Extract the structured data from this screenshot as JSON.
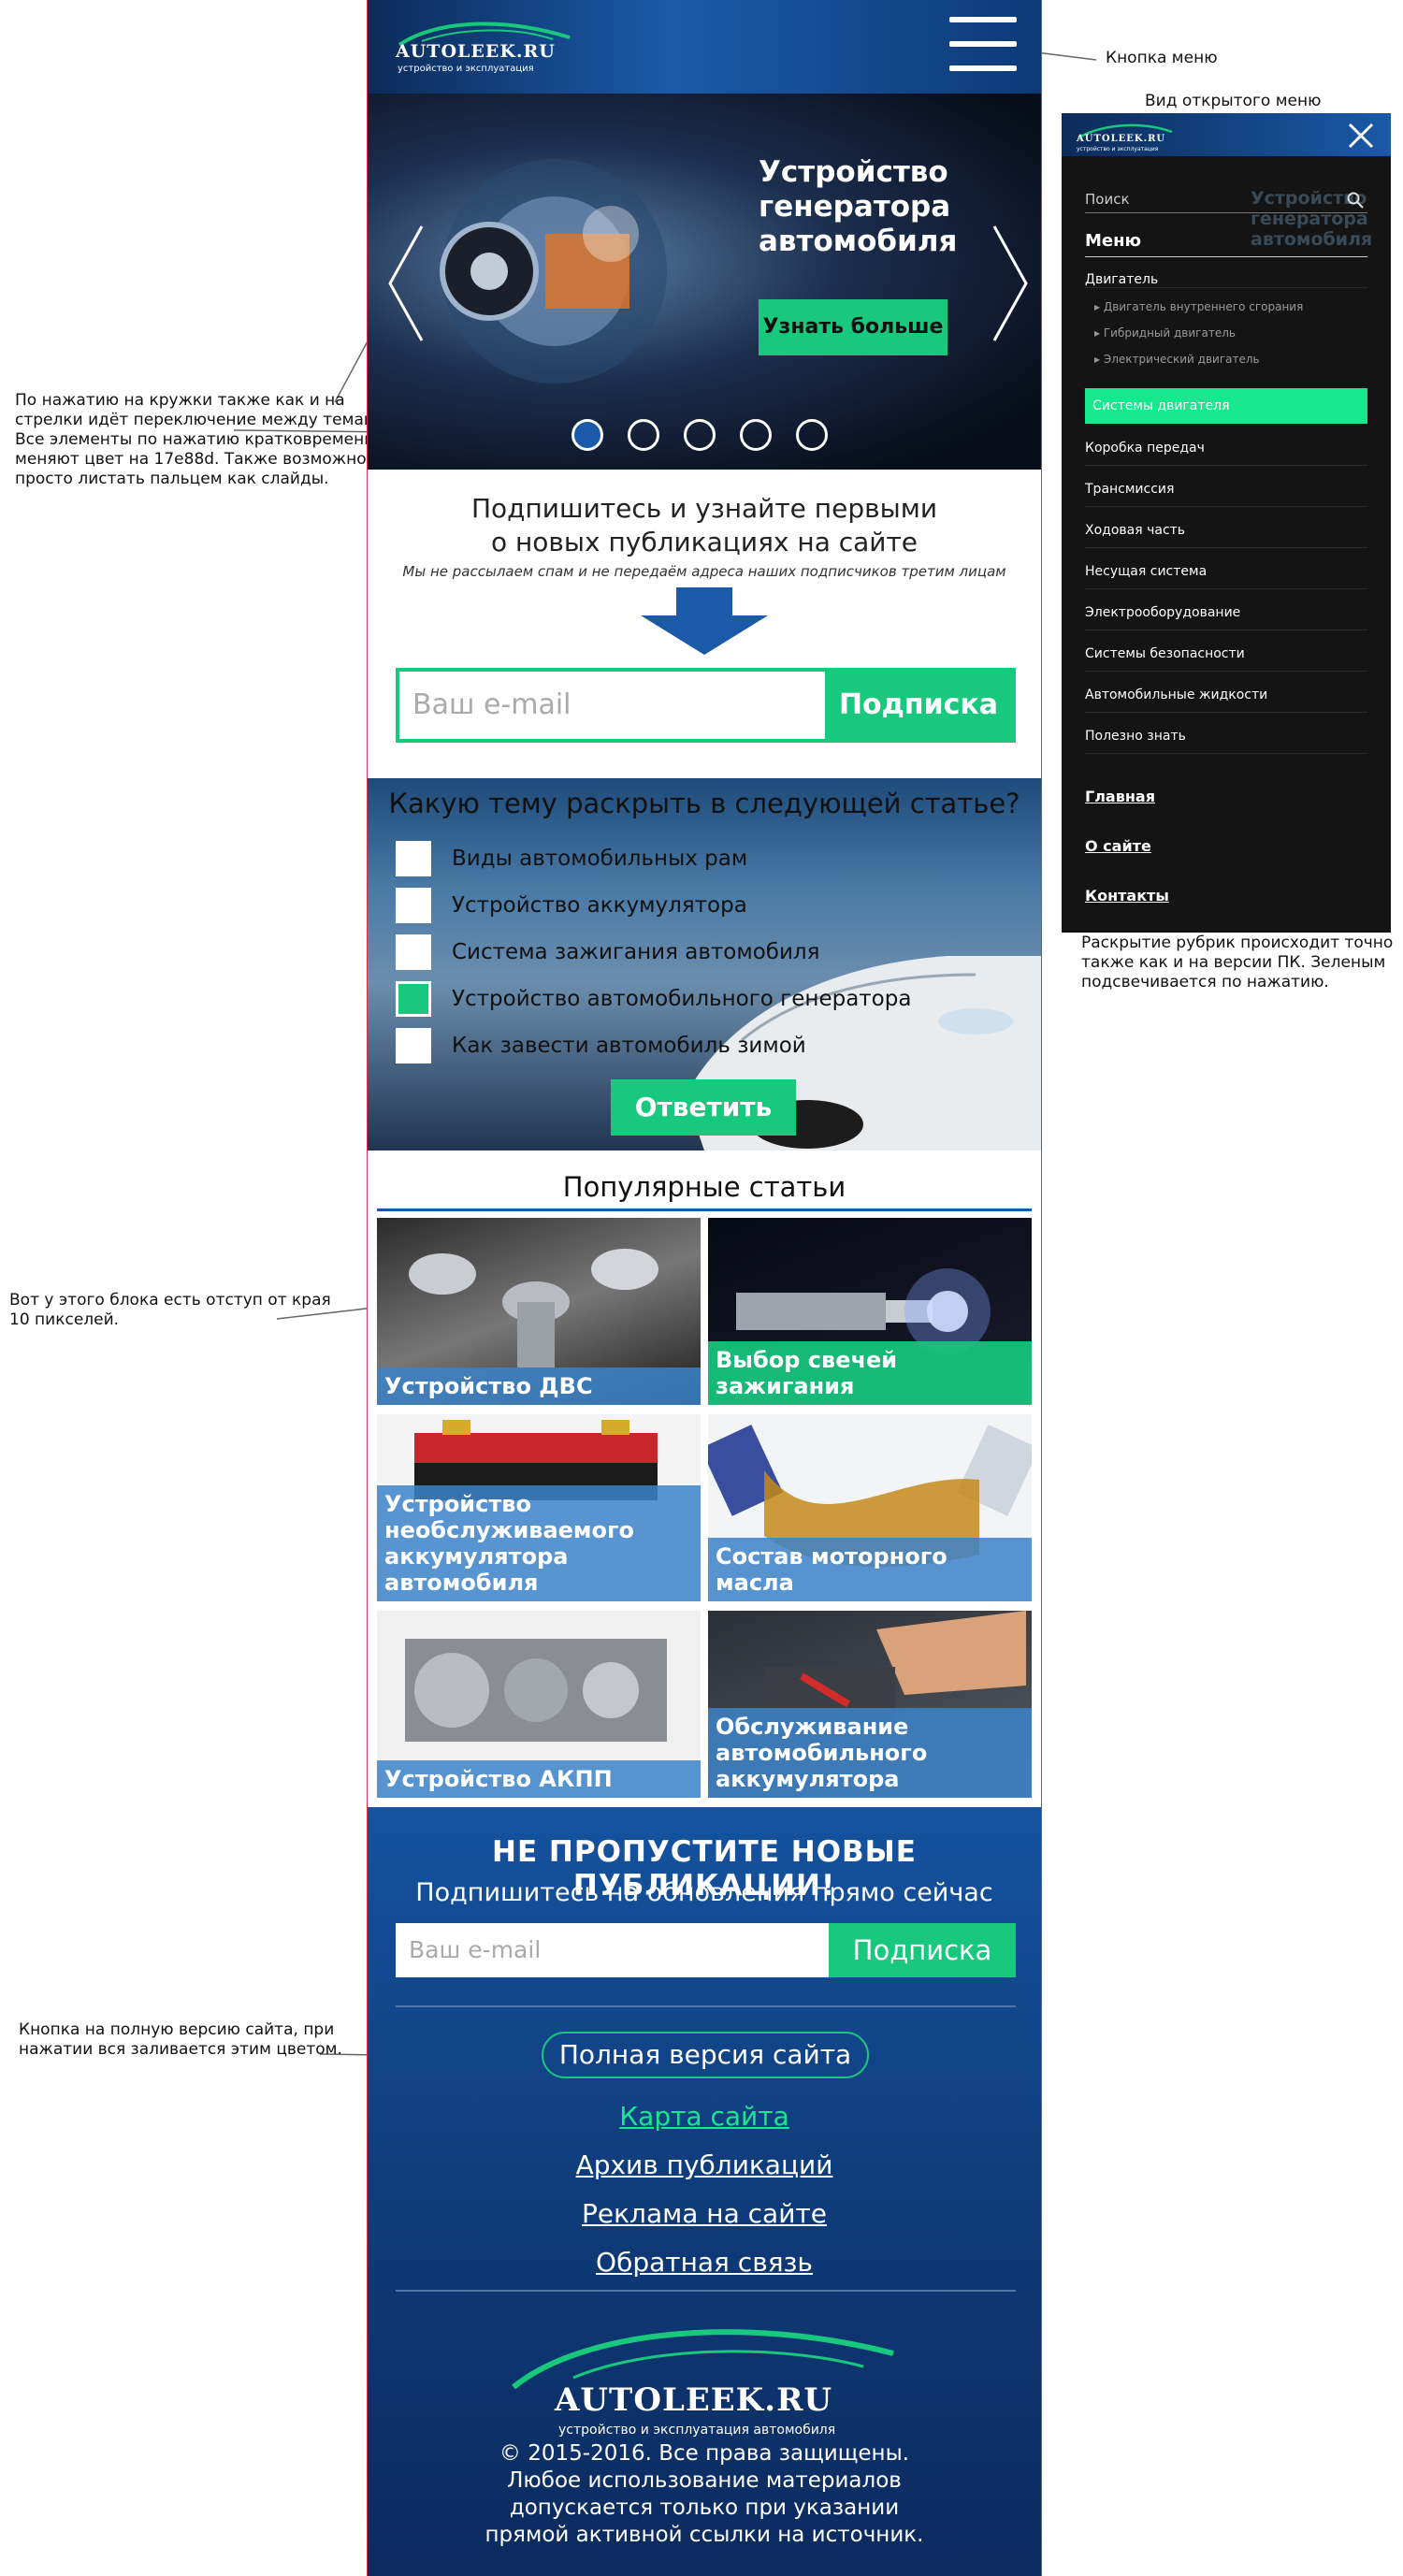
{
  "annotations": {
    "menu_button": "Кнопка меню",
    "menu_open_view": "Вид открытого меню",
    "slider_note": [
      "По нажатию на кружки также как и на",
      "стрелки идёт переключение между темами.",
      "Все элементы по нажатию кратковременно",
      "меняют цвет на 17e88d. Также возможно",
      "просто листать пальцем как слайды."
    ],
    "block_note": [
      "Вот у этого блока есть отступ от края",
      "10 пикселей."
    ],
    "full_version_note": [
      "Кнопка на полную версию сайта, при",
      "нажатии вся заливается этим цветом."
    ],
    "menu_note": [
      "Раскрытие рубрик происходит точно",
      "также как и на версии ПК. Зеленым",
      "подсвечивается по нажатию."
    ]
  },
  "header": {
    "brand": "AUTOLEEK.RU",
    "tagline": "устройство и эксплуатация"
  },
  "hero": {
    "title_lines": [
      "Устройство",
      "генератора",
      "автомобиля"
    ],
    "button": "Узнать больше",
    "slides_count": 5,
    "active_slide": 1
  },
  "subscribe": {
    "title_lines": [
      "Подпишитесь и узнайте первыми",
      "о новых публикациях на сайте"
    ],
    "note": "Мы не рассылаем спам и не передаём адреса наших подписчиков третим лицам",
    "email_placeholder": "Ваш e-mail",
    "button": "Подписка"
  },
  "poll": {
    "question": "Какую тему раскрыть в следующей статье?",
    "options": [
      {
        "label": "Виды автомобильных рам",
        "checked": false
      },
      {
        "label": "Устройство аккумулятора",
        "checked": false
      },
      {
        "label": "Система зажигания автомобиля",
        "checked": false
      },
      {
        "label": "Устройство автомобильного генератора",
        "checked": true
      },
      {
        "label": "Как завести автомобиль зимой",
        "checked": false
      }
    ],
    "button": "Ответить"
  },
  "popular": {
    "title": "Популярные статьи",
    "cards": [
      {
        "caption": "Устройство ДВС",
        "highlight": false
      },
      {
        "caption": "Выбор свечей зажигания",
        "highlight": true
      },
      {
        "caption": "Устройство необслуживаемого аккумулятора автомобиля",
        "highlight": false
      },
      {
        "caption": "Состав моторного масла",
        "highlight": false
      },
      {
        "caption": "Устройство АКПП",
        "highlight": false
      },
      {
        "caption": "Обслуживание автомобильного аккумулятора",
        "highlight": false
      }
    ]
  },
  "footer": {
    "heading": "НЕ ПРОПУСТИТЕ НОВЫЕ ПУБЛИКАЦИИ!",
    "lead": "Подпишитесь на обновления прямо сейчас",
    "email_placeholder": "Ваш e-mail",
    "button": "Подписка",
    "full_version": "Полная версия сайта",
    "links": [
      {
        "label": "Карта сайта",
        "active": true
      },
      {
        "label": "Архив публикаций",
        "active": false
      },
      {
        "label": "Реклама на сайте",
        "active": false
      },
      {
        "label": "Обратная связь",
        "active": false
      }
    ],
    "logo_brand": "AUTOLEEK.RU",
    "logo_tagline": "устройство и эксплуатация автомобиля",
    "copyright_lines": [
      "© 2015-2016. Все права защищены.",
      "Любое использование материалов",
      "допускается только при указании",
      "прямой активной ссылки на источник."
    ]
  },
  "menu": {
    "search_placeholder": "Поиск",
    "heading": "Меню",
    "engine": "Двигатель",
    "engine_sub": [
      "Двигатель внутреннего сгорания",
      "Гибридный двигатель",
      "Электрический двигатель"
    ],
    "active_item": "Системы двигателя",
    "items": [
      "Коробка передач",
      "Трансмиссия",
      "Ходовая часть",
      "Несущая система",
      "Электрооборудование",
      "Системы безопасности",
      "Автомобильные жидкости",
      "Полезно знать"
    ],
    "bold_links": [
      "Главная",
      "О сайте",
      "Контакты"
    ]
  },
  "colors": {
    "accent_green": "#17c87d",
    "highlight_green": "#17e88d",
    "brand_blue": "#1a5aa8",
    "border_red": "#d6344a"
  }
}
